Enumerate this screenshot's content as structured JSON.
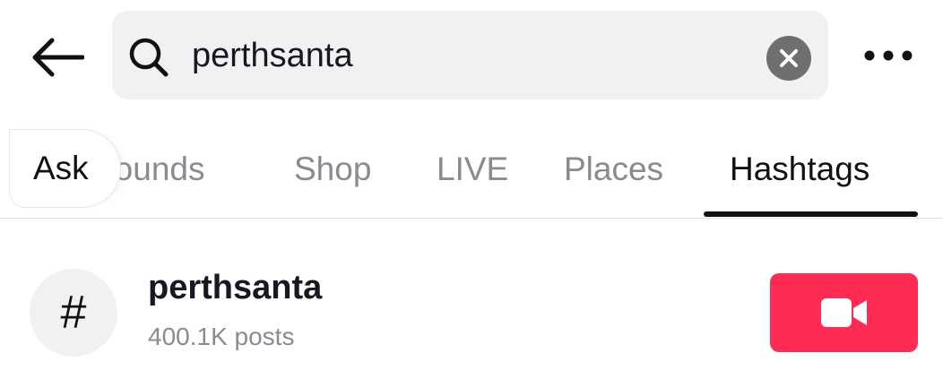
{
  "header": {
    "back_icon": "arrow-left-icon",
    "search": {
      "icon": "search-icon",
      "value": "perthsanta",
      "clear_icon": "close-circle-icon"
    },
    "more_icon": "more-horizontal-icon"
  },
  "tabs": {
    "ask_label": "Ask",
    "items": [
      {
        "label": "Sounds",
        "active": false
      },
      {
        "label": "Shop",
        "active": false
      },
      {
        "label": "LIVE",
        "active": false
      },
      {
        "label": "Places",
        "active": false
      },
      {
        "label": "Hashtags",
        "active": true
      }
    ]
  },
  "results": [
    {
      "icon_symbol": "#",
      "title": "perthsanta",
      "meta": "400.1K posts",
      "action_icon": "video-camera-icon"
    }
  ],
  "colors": {
    "accent": "#fe2c55",
    "search_bg": "#f1f1f2",
    "muted_text": "#8a8b91",
    "clear_bg": "#6f6f70"
  }
}
